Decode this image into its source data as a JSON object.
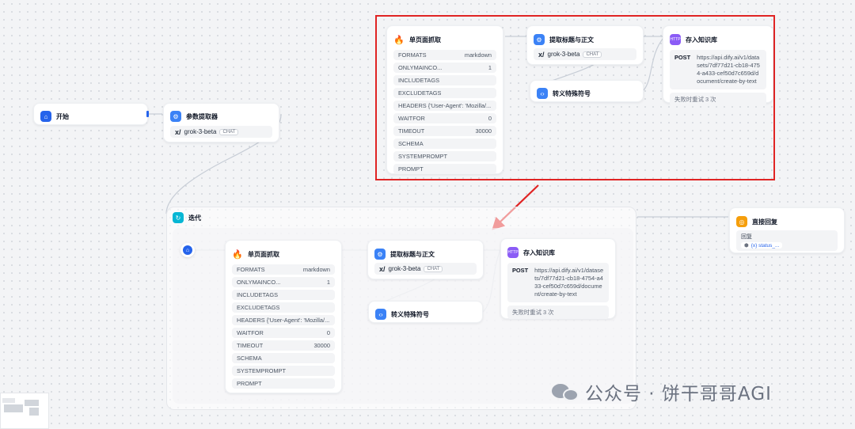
{
  "colors": {
    "accent": "#2563eb",
    "highlight": "#e02424"
  },
  "start": {
    "title": "开始",
    "icon": "home-icon"
  },
  "param": {
    "title": "参数提取器",
    "model": "grok-3-beta",
    "model_tag": "CHAT"
  },
  "iteration": {
    "title": "迭代"
  },
  "reply": {
    "title": "直接回复",
    "label": "回复",
    "var": "{x} status_..."
  },
  "scrape": {
    "title": "单页面抓取",
    "fields": [
      {
        "k": "FORMATS",
        "v": "markdown"
      },
      {
        "k": "ONLYMAINCO...",
        "v": "1"
      },
      {
        "k": "INCLUDETAGS",
        "v": ""
      },
      {
        "k": "EXCLUDETAGS",
        "v": ""
      },
      {
        "k": "HEADERS {'User-Agent': 'Mozilla/...",
        "v": ""
      },
      {
        "k": "WAITFOR",
        "v": "0"
      },
      {
        "k": "TIMEOUT",
        "v": "30000"
      },
      {
        "k": "SCHEMA",
        "v": ""
      },
      {
        "k": "SYSTEMPROMPT",
        "v": ""
      },
      {
        "k": "PROMPT",
        "v": ""
      }
    ]
  },
  "extract": {
    "title": "提取标题与正文",
    "model": "grok-3-beta",
    "model_tag": "CHAT"
  },
  "escape": {
    "title": "转义特殊符号"
  },
  "store": {
    "title": "存入知识库",
    "method": "POST",
    "url": "https://api.dify.ai/v1/datasets/7df77d21-cb18-4754-a433-cef50d7c659d/document/create-by-text",
    "retry": "失败时重试 3 次",
    "http_tag": "HTTP"
  },
  "watermark": "公众号 · 饼干哥哥AGI"
}
